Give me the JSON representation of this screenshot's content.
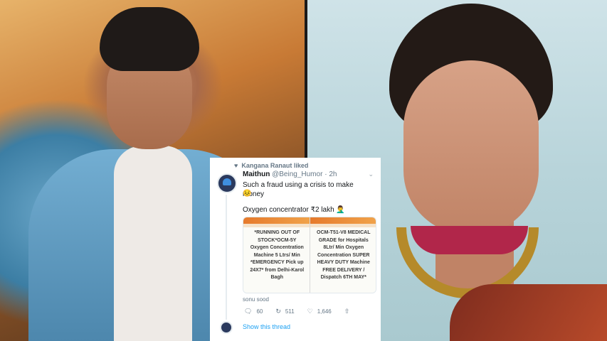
{
  "tweet": {
    "liked_by": "Kangana Ranaut liked",
    "author_name": "Maithun",
    "author_handle": "@Being_Humor",
    "separator": "·",
    "time": "2h",
    "text_line1": "Such a fraud using a crisis to make money",
    "emoji": "😣",
    "text_line2": "Oxygen concentrator ₹2 lakh 🤦‍♂️",
    "ad_left_lines": [
      "*RUNNING OUT OF",
      "STOCK*OCM-5Y",
      "Oxygen Concentration",
      "Machine 5 Ltrs/ Min",
      "*EMERGENCY Pick up",
      "24X7* from Delhi-Karol",
      "Bagh"
    ],
    "ad_right_lines": [
      "OCM-T51-V8 MEDICAL",
      "GRADE for Hospitals",
      "8Ltr/ Min Oxygen",
      "Concentration SUPER",
      "HEAVY DUTY Machine",
      "FREE DELIVERY /",
      "Dispatch 6TH MAY*"
    ],
    "caption": "sonu sood",
    "replies": "60",
    "retweets": "511",
    "likes": "1,646",
    "show_thread": "Show this thread"
  },
  "icons": {
    "heart_small": "heart-icon",
    "reply": "reply-icon",
    "retweet": "retweet-icon",
    "like": "like-icon",
    "share": "share-icon",
    "chevron": "chevron-down-icon"
  },
  "colors": {
    "link": "#1da1f2",
    "muted": "#657786"
  }
}
